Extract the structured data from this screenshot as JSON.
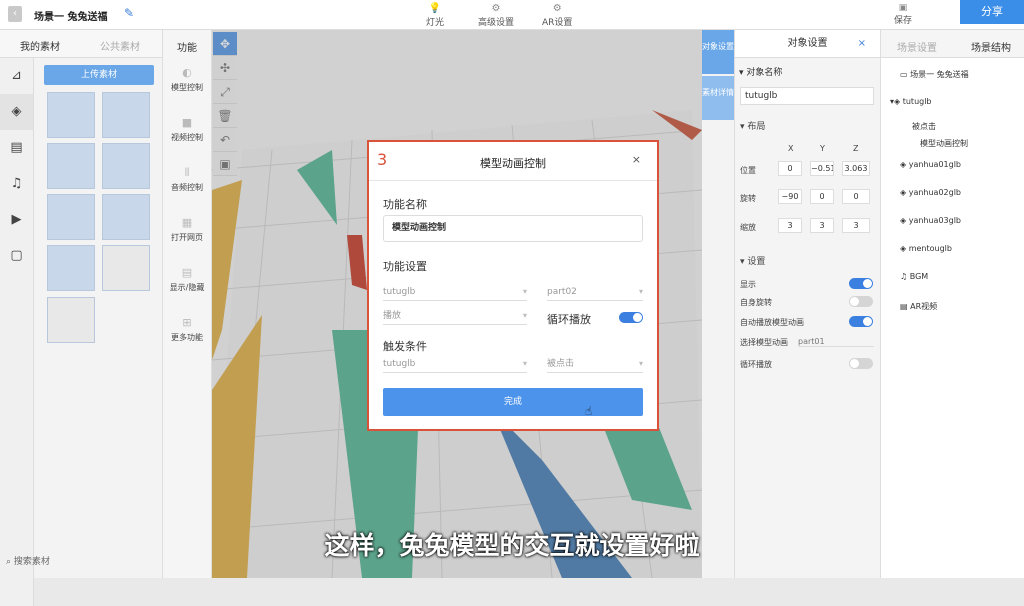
{
  "topbar": {
    "title": "场景一 兔兔送福",
    "tools": [
      "灯光",
      "高级设置",
      "AR设置"
    ],
    "save": "保存",
    "share": "分享"
  },
  "left": {
    "tab_mine": "我的素材",
    "tab_public": "公共素材",
    "upload": "上传素材",
    "search": "搜索素材"
  },
  "func": {
    "header": "功能",
    "items": [
      "模型控制",
      "视频控制",
      "音频控制",
      "打开网页",
      "显示/隐藏",
      "更多功能"
    ]
  },
  "sidetabs": [
    "对象设置",
    "素材详情"
  ],
  "props": {
    "title": "对象设置",
    "close": "×",
    "name_label": "对象名称",
    "name_value": "tutuglb",
    "layout": "布局",
    "x": "X",
    "y": "Y",
    "z": "Z",
    "pos": "位置",
    "rot": "旋转",
    "scale": "缩放",
    "posv": [
      "0",
      "−0.514",
      "3.063"
    ],
    "rotv": [
      "−90",
      "0",
      "0"
    ],
    "scalev": [
      "3",
      "3",
      "3"
    ],
    "settings": "设置",
    "show": "显示",
    "spin": "自身旋转",
    "autoplay": "自动播放模型动画",
    "choose": "选择模型动画",
    "choose_v": "part01",
    "loop": "循环播放"
  },
  "tree": {
    "tab1": "场景设置",
    "tab2": "场景结构",
    "items": [
      "场景一 兔兔送福",
      "tutuglb",
      "被点击",
      "模型动画控制",
      "yanhua01glb",
      "yanhua02glb",
      "yanhua03glb",
      "mentouglb",
      "BGM",
      "AR视频"
    ]
  },
  "modal": {
    "num": "3",
    "title": "模型动画控制",
    "close": "×",
    "fname_label": "功能名称",
    "fname": "模型动画控制",
    "settings": "功能设置",
    "s1": "tutuglb",
    "s2": "part02",
    "s3": "播放",
    "loop": "循环播放",
    "trigger": "触发条件",
    "t1": "tutuglb",
    "t2": "被点击",
    "done": "完成"
  },
  "subtitle": "这样，兔兔模型的交互就设置好啦"
}
